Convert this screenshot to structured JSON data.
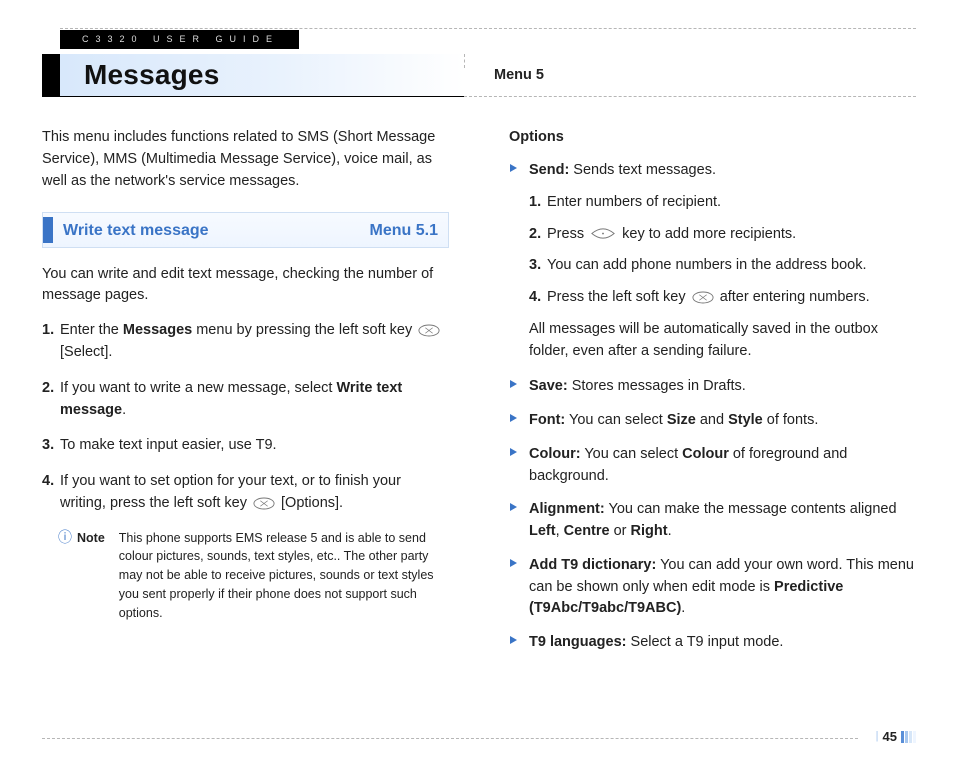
{
  "header": {
    "guide_label": "C3320 USER GUIDE",
    "chapter_title": "Messages",
    "menu_ref": "Menu 5"
  },
  "left": {
    "intro": "This menu includes functions related to SMS (Short Message Service), MMS (Multimedia Message Service), voice mail, as well as the network's service messages.",
    "section": {
      "title": "Write text message",
      "menu": "Menu 5.1"
    },
    "lead": "You can write and edit text message, checking the number of message pages.",
    "steps": {
      "s1_a": "Enter the ",
      "s1_b": "Messages",
      "s1_c": " menu by pressing the left soft key ",
      "s1_d": " [Select].",
      "s2_a": "If you want to write a new message, select ",
      "s2_b": "Write text message",
      "s2_c": ".",
      "s3": "To make text input easier, use T9.",
      "s4_a": "If you want to set option for your text, or to finish your writing, press the left soft key ",
      "s4_b": " [Options]."
    },
    "note": {
      "label": "Note",
      "text": "This phone supports EMS release 5 and is able to send colour pictures, sounds, text styles, etc.. The other party may not be able to receive pictures, sounds or text styles you sent properly if their phone does not support such options."
    }
  },
  "right": {
    "options_label": "Options",
    "send": {
      "label": "Send:",
      "desc": " Sends text messages.",
      "s1": "Enter numbers of recipient.",
      "s2_a": "Press ",
      "s2_b": " key to add more recipients.",
      "s3": "You can add phone numbers in the address book.",
      "s4_a": "Press the left soft key ",
      "s4_b": " after entering numbers.",
      "tail": "All messages will be automatically saved in the outbox folder, even after a sending failure."
    },
    "save": {
      "label": "Save:",
      "desc": " Stores messages in Drafts."
    },
    "font": {
      "label": "Font:",
      "a": " You can select ",
      "b": "Size",
      "c": " and ",
      "d": "Style",
      "e": " of fonts."
    },
    "colour": {
      "label": "Colour:",
      "a": " You can select ",
      "b": "Colour",
      "c": " of foreground and background."
    },
    "align": {
      "label": "Alignment:",
      "a": " You can make the message contents aligned ",
      "b": "Left",
      "c": ", ",
      "d": "Centre",
      "e": " or ",
      "f": "Right",
      "g": "."
    },
    "t9dict": {
      "label": "Add T9 dictionary:",
      "a": " You can add your own word. This menu can be shown only when edit mode is ",
      "b": "Predictive (T9Abc/T9abc/T9ABC)",
      "c": "."
    },
    "t9lang": {
      "label": "T9 languages:",
      "desc": " Select a T9 input mode."
    }
  },
  "footer": {
    "page_number": "45"
  }
}
